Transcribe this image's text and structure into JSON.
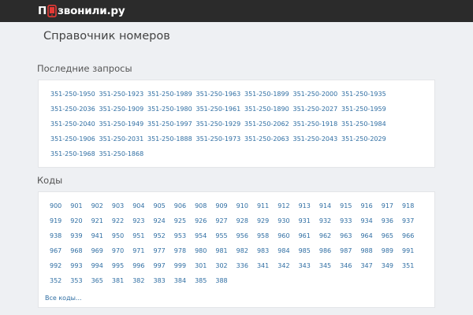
{
  "header": {
    "logo_prefix": "П",
    "logo_suffix": "звонили.ру",
    "logo_accent": "#e53935"
  },
  "page": {
    "title": "Справочник номеров"
  },
  "recent": {
    "title": "Последние запросы",
    "numbers": [
      "351-250-1950",
      "351-250-1923",
      "351-250-1989",
      "351-250-1963",
      "351-250-1899",
      "351-250-2000",
      "351-250-1935",
      "351-250-2036",
      "351-250-1909",
      "351-250-1980",
      "351-250-1961",
      "351-250-1890",
      "351-250-2027",
      "351-250-1959",
      "351-250-2040",
      "351-250-1949",
      "351-250-1997",
      "351-250-1929",
      "351-250-2062",
      "351-250-1918",
      "351-250-1984",
      "351-250-1906",
      "351-250-2031",
      "351-250-1888",
      "351-250-1973",
      "351-250-2063",
      "351-250-2043",
      "351-250-2029",
      "351-250-1968",
      "351-250-1868"
    ]
  },
  "codes": {
    "title": "Коды",
    "items": [
      "900",
      "901",
      "902",
      "903",
      "904",
      "905",
      "906",
      "908",
      "909",
      "910",
      "911",
      "912",
      "913",
      "914",
      "915",
      "916",
      "917",
      "918",
      "919",
      "920",
      "921",
      "922",
      "923",
      "924",
      "925",
      "926",
      "927",
      "928",
      "929",
      "930",
      "931",
      "932",
      "933",
      "934",
      "936",
      "937",
      "938",
      "939",
      "941",
      "950",
      "951",
      "952",
      "953",
      "954",
      "955",
      "956",
      "958",
      "960",
      "961",
      "962",
      "963",
      "964",
      "965",
      "966",
      "967",
      "968",
      "969",
      "970",
      "971",
      "977",
      "978",
      "980",
      "981",
      "982",
      "983",
      "984",
      "985",
      "986",
      "987",
      "988",
      "989",
      "991",
      "992",
      "993",
      "994",
      "995",
      "996",
      "997",
      "999",
      "301",
      "302",
      "336",
      "341",
      "342",
      "343",
      "345",
      "346",
      "347",
      "349",
      "351",
      "352",
      "353",
      "365",
      "381",
      "382",
      "383",
      "384",
      "385",
      "388"
    ],
    "all_label": "Все коды..."
  }
}
